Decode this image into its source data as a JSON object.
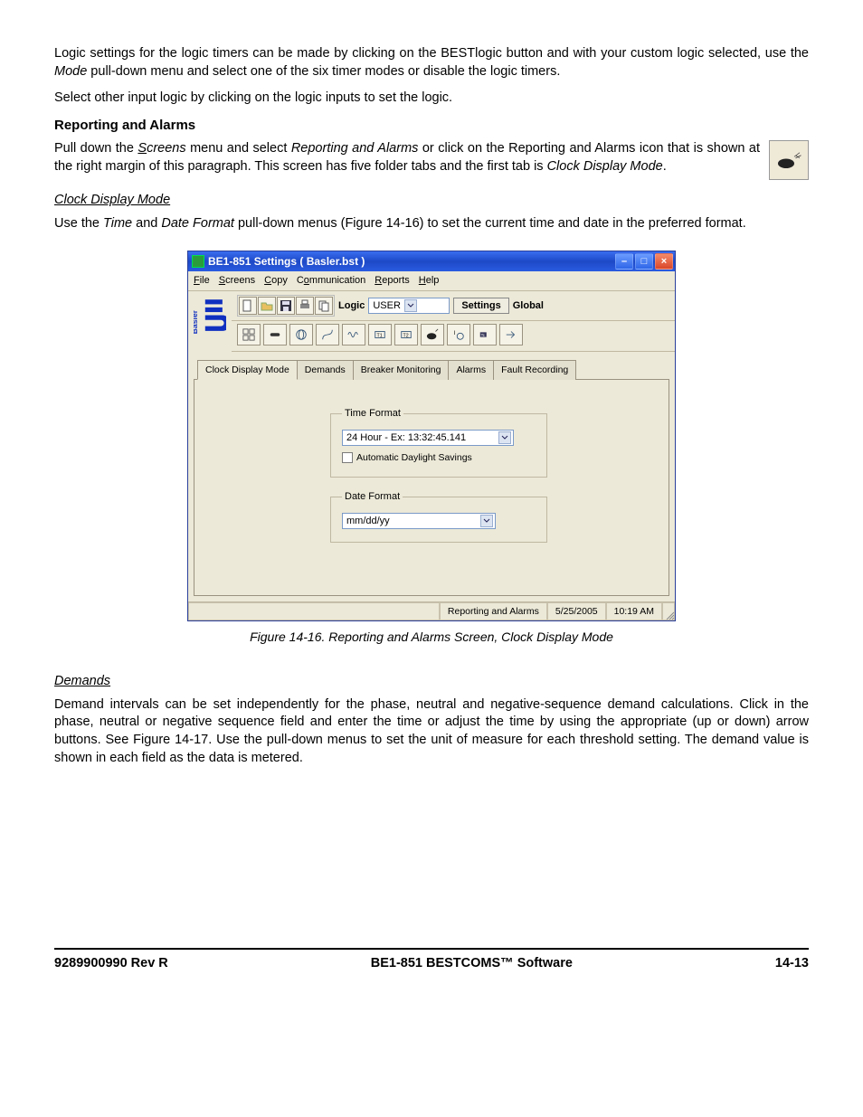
{
  "body": {
    "p1_a": "Logic settings for the logic timers can be made by clicking on the BESTlogic button and with your custom logic selected, use the ",
    "p1_mode": "Mode",
    "p1_b": " pull-down menu and select one of the six timer modes or disable the logic timers.",
    "p2": "Select other input logic by clicking on the logic inputs to set the logic.",
    "h1": "Reporting and Alarms",
    "p3_a": "Pull down the ",
    "p3_screens_u": "S",
    "p3_screens_rest": "creens",
    "p3_b": " menu and select ",
    "p3_ra": "Reporting and Alarms",
    "p3_c": " or click on the Reporting and Alarms icon that is shown at the right margin of this paragraph. This screen has five folder tabs and the first tab is ",
    "p3_cdm": "Clock Display Mode",
    "p3_d": ".",
    "h2": "Clock Display Mode",
    "p4_a": "Use the ",
    "p4_time": "Time",
    "p4_b": " and ",
    "p4_df": "Date Format",
    "p4_c": " pull-down menus (Figure 14-16) to set the current time and date in the preferred format.",
    "fig_caption": "Figure 14-16. Reporting and Alarms Screen, Clock Display Mode",
    "h3": "Demands",
    "p5": "Demand intervals can be set independently for the phase, neutral and negative-sequence demand calculations. Click in the phase, neutral or negative sequence field and enter the time or adjust the time by using the appropriate (up or down) arrow buttons. See Figure 14-17. Use the pull-down menus to set the unit of measure for each threshold setting. The demand value is shown in each field as the data is metered."
  },
  "app": {
    "title": "BE1-851 Settings   ( Basler.bst )",
    "menu": {
      "file": "File",
      "screens": "Screens",
      "copy": "Copy",
      "comm": "Communication",
      "reports": "Reports",
      "help": "Help"
    },
    "toolbar": {
      "logic_label": "Logic",
      "logic_value": "USER",
      "settings_btn": "Settings",
      "global_label": "Global"
    },
    "tabs": {
      "t0": "Clock Display Mode",
      "t1": "Demands",
      "t2": "Breaker Monitoring",
      "t3": "Alarms",
      "t4": "Fault Recording"
    },
    "timeformat": {
      "legend": "Time Format",
      "value": "24 Hour - Ex: 13:32:45.141",
      "dst": "Automatic Daylight Savings"
    },
    "dateformat": {
      "legend": "Date Format",
      "value": "mm/dd/yy"
    },
    "status": {
      "screen": "Reporting and Alarms",
      "date": "5/25/2005",
      "time": "10:19 AM"
    }
  },
  "footer": {
    "left": "9289900990 Rev R",
    "center": "BE1-851 BESTCOMS™ Software",
    "right": "14-13"
  }
}
